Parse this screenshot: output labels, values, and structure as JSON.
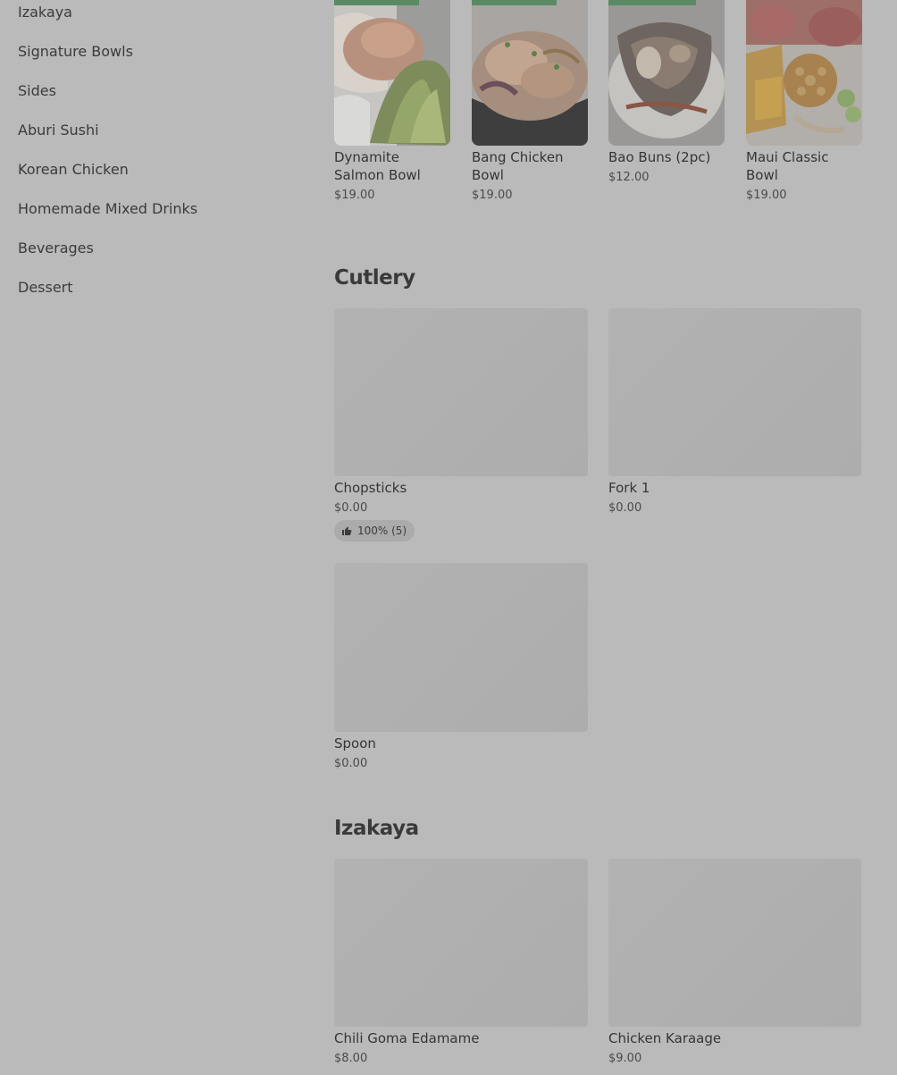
{
  "sidebar": {
    "items": [
      {
        "label": "Izakaya"
      },
      {
        "label": "Signature Bowls"
      },
      {
        "label": "Sides"
      },
      {
        "label": "Aburi Sushi"
      },
      {
        "label": "Korean Chicken"
      },
      {
        "label": "Homemade Mixed Drinks"
      },
      {
        "label": "Beverages"
      },
      {
        "label": "Dessert"
      }
    ]
  },
  "top_items": [
    {
      "name": "Dynamite Salmon Bowl",
      "price": "$19.00"
    },
    {
      "name": "Bang Chicken Bowl",
      "price": "$19.00"
    },
    {
      "name": "Bao Buns (2pc)",
      "price": "$12.00"
    },
    {
      "name": "Maui Classic Bowl",
      "price": "$19.00"
    }
  ],
  "cutlery": {
    "title": "Cutlery",
    "items": [
      {
        "name": "Chopsticks",
        "price": "$0.00",
        "rating": "100% (5)"
      },
      {
        "name": "Fork 1",
        "price": "$0.00"
      },
      {
        "name": "Spoon",
        "price": "$0.00"
      }
    ]
  },
  "izakaya": {
    "title": "Izakaya",
    "items": [
      {
        "name": "Chili Goma Edamame",
        "price": "$8.00"
      },
      {
        "name": "Chicken Karaage",
        "price": "$9.00"
      }
    ]
  },
  "icons": {
    "rating": "thumbs-up-icon"
  },
  "colors": {
    "overlay": "#bababa",
    "accent_green": "#5a8a63"
  }
}
